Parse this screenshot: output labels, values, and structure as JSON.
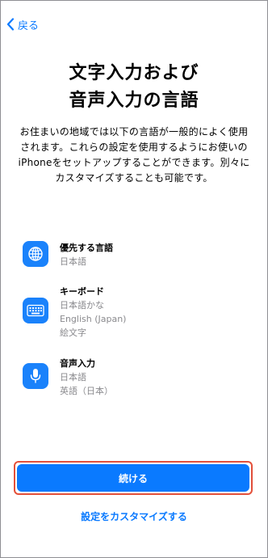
{
  "nav": {
    "back_label": "戻る"
  },
  "title": {
    "line1": "文字入力および",
    "line2": "音声入力の言語"
  },
  "description": "お住まいの地域では以下の言語が一般的によく使用されます。これらの設定を使用するようにお使いのiPhoneをセットアップすることができます。別々にカスタマイズすることも可能です。",
  "items": [
    {
      "icon": "globe-icon",
      "title": "優先する言語",
      "lines": [
        "日本語"
      ]
    },
    {
      "icon": "keyboard-icon",
      "title": "キーボード",
      "lines": [
        "日本語かな",
        "English (Japan)",
        "絵文字"
      ]
    },
    {
      "icon": "microphone-icon",
      "title": "音声入力",
      "lines": [
        "日本語",
        "英語（日本）"
      ]
    }
  ],
  "buttons": {
    "continue_label": "続ける",
    "customize_label": "設定をカスタマイズする"
  },
  "colors": {
    "accent": "#0a7aff",
    "icon_bg": "#1a82fb",
    "highlight_outline": "#e4503a"
  }
}
